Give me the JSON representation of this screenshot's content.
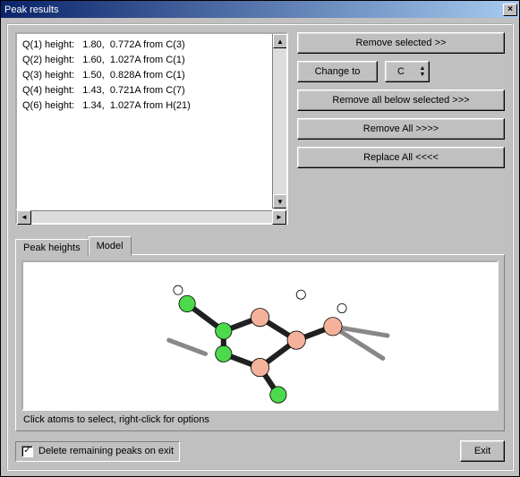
{
  "window": {
    "title": "Peak results"
  },
  "peaks": [
    {
      "name": "Q(1) height:",
      "h": "1.80,",
      "d": "0.772A from C(3)"
    },
    {
      "name": "Q(2) height:",
      "h": "1.60,",
      "d": "1.027A from C(1)"
    },
    {
      "name": "Q(3) height:",
      "h": "1.50,",
      "d": "0.828A from C(1)"
    },
    {
      "name": "Q(4) height:",
      "h": "1.43,",
      "d": "0.721A from C(7)"
    },
    {
      "name": "Q(6) height:",
      "h": "1.34,",
      "d": "1.027A from H(21)"
    }
  ],
  "buttons": {
    "remove_selected": "Remove selected >>",
    "change_to": "Change to",
    "element": "C",
    "remove_below": "Remove all below selected >>>",
    "remove_all": "Remove All  >>>>",
    "replace_all": "Replace All <<<<",
    "exit": "Exit"
  },
  "tabs": {
    "peak_heights": "Peak heights",
    "model": "Model"
  },
  "hint": "Click atoms to select, right-click for options",
  "checkbox": {
    "label": "Delete remaining peaks on exit",
    "checked": true
  },
  "colors": {
    "atom_pink": "#f4b29a",
    "atom_green": "#4cd94c",
    "atom_white": "#ffffff",
    "bond": "#202020"
  }
}
